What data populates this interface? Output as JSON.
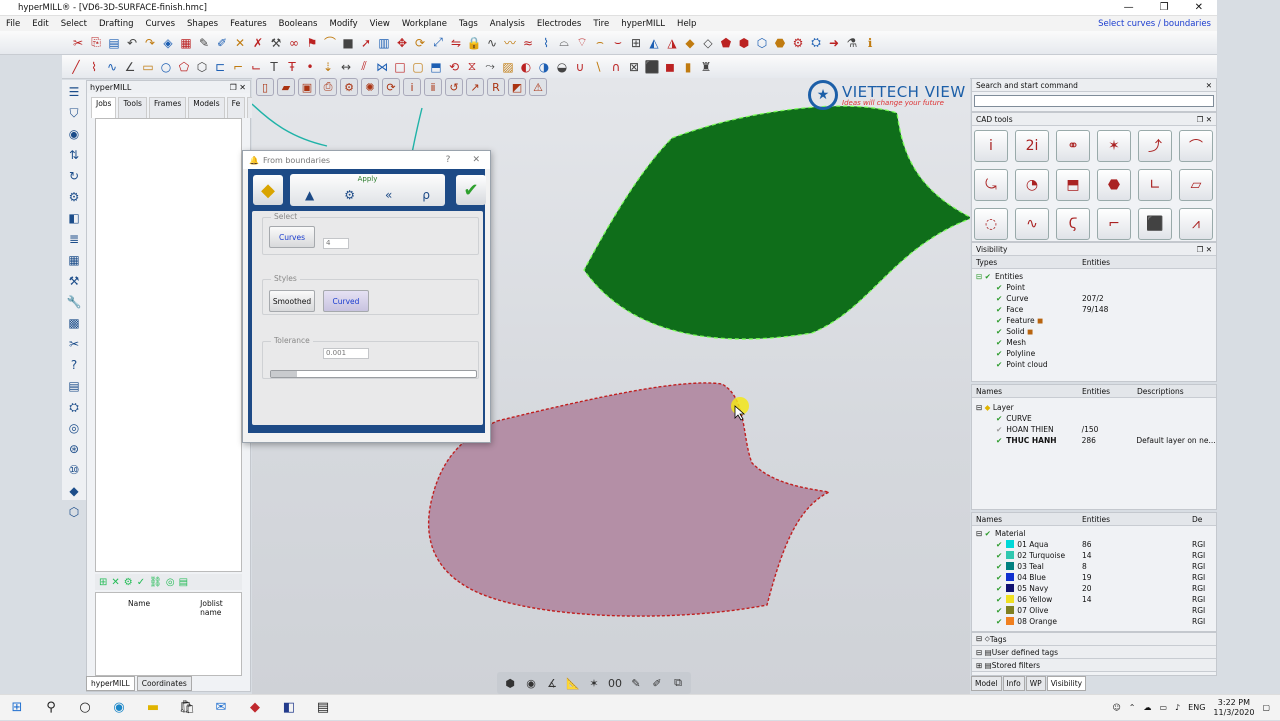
{
  "title": "hyperMILL® - [VD6-3D-SURFACE-finish.hmc]",
  "window_controls": [
    "—",
    "❐",
    "✕"
  ],
  "menu": [
    "File",
    "Edit",
    "Select",
    "Drafting",
    "Curves",
    "Shapes",
    "Features",
    "Booleans",
    "Modify",
    "View",
    "Workplane",
    "Tags",
    "Analysis",
    "Electrodes",
    "Tire",
    "hyperMILL",
    "Help"
  ],
  "status_hint": "Select curves / boundaries",
  "left_panel": {
    "title": "hyperMILL",
    "tabs": [
      "Jobs",
      "Tools",
      "Frames",
      "Models",
      "Fe"
    ],
    "col_name": "Name",
    "col_joblist": "Joblist name",
    "bottom_tabs": [
      "hyperMILL",
      "Coordinates"
    ]
  },
  "logo": {
    "name": "VIETTECH VIEW",
    "slogan": "Ideas will change your future"
  },
  "dialog": {
    "title": "From boundaries",
    "help": "?",
    "close": "✕",
    "apply": "Apply",
    "select_group": "Select",
    "curves_btn": "Curves",
    "curves_count": "4",
    "styles_group": "Styles",
    "smoothed_btn": "Smoothed",
    "curved_btn": "Curved",
    "tolerance_group": "Tolerance",
    "tolerance_value": "0.001"
  },
  "right": {
    "search_title": "Search and start command",
    "cad_title": "CAD tools",
    "vis_title": "Visibility",
    "types_cols": [
      "Types",
      "Entities"
    ],
    "types": [
      {
        "name": "Entities",
        "val": ""
      },
      {
        "name": "Point",
        "val": ""
      },
      {
        "name": "Curve",
        "val": "207/2"
      },
      {
        "name": "Face",
        "val": "79/148"
      },
      {
        "name": "Feature",
        "val": ""
      },
      {
        "name": "Solid",
        "val": ""
      },
      {
        "name": "Mesh",
        "val": ""
      },
      {
        "name": "Polyline",
        "val": ""
      },
      {
        "name": "Point cloud",
        "val": ""
      }
    ],
    "layer_cols": [
      "Names",
      "Entities",
      "Descriptions"
    ],
    "layers": [
      {
        "name": "Layer",
        "ent": "",
        "desc": ""
      },
      {
        "name": "CURVE",
        "ent": "",
        "desc": ""
      },
      {
        "name": "HOAN THIEN",
        "ent": "/150",
        "desc": ""
      },
      {
        "name": "THUC HANH",
        "ent": "286",
        "desc": "Default layer on ne..."
      }
    ],
    "mat_cols": [
      "Names",
      "Entities",
      "De"
    ],
    "materials": [
      {
        "name": "Material",
        "ent": "",
        "de": "",
        "color": "#ffffff"
      },
      {
        "name": "01 Aqua",
        "ent": "86",
        "de": "RGI",
        "color": "#00d8d8"
      },
      {
        "name": "02 Turquoise",
        "ent": "14",
        "de": "RGI",
        "color": "#30c8b0"
      },
      {
        "name": "03 Teal",
        "ent": "8",
        "de": "RGI",
        "color": "#008080"
      },
      {
        "name": "04 Blue",
        "ent": "19",
        "de": "RGI",
        "color": "#1030d0"
      },
      {
        "name": "05 Navy",
        "ent": "20",
        "de": "RGI",
        "color": "#101070"
      },
      {
        "name": "06 Yellow",
        "ent": "14",
        "de": "RGI",
        "color": "#f0e020"
      },
      {
        "name": "07 Olive",
        "ent": "",
        "de": "RGI",
        "color": "#808020"
      },
      {
        "name": "08 Orange",
        "ent": "",
        "de": "RGI",
        "color": "#f08020"
      }
    ],
    "tags": "Tags",
    "user_tags": "User defined tags",
    "stored": "Stored filters",
    "bottom_tabs": [
      "Model",
      "Info",
      "WP",
      "Visibility"
    ]
  },
  "taskbar": {
    "lang": "ENG",
    "time": "3:22 PM",
    "date": "11/3/2020"
  },
  "colors": {
    "green_surface": "#0f6e1a",
    "pink_surface": "#b48fa6",
    "dialog_blue": "#1d4a86"
  }
}
